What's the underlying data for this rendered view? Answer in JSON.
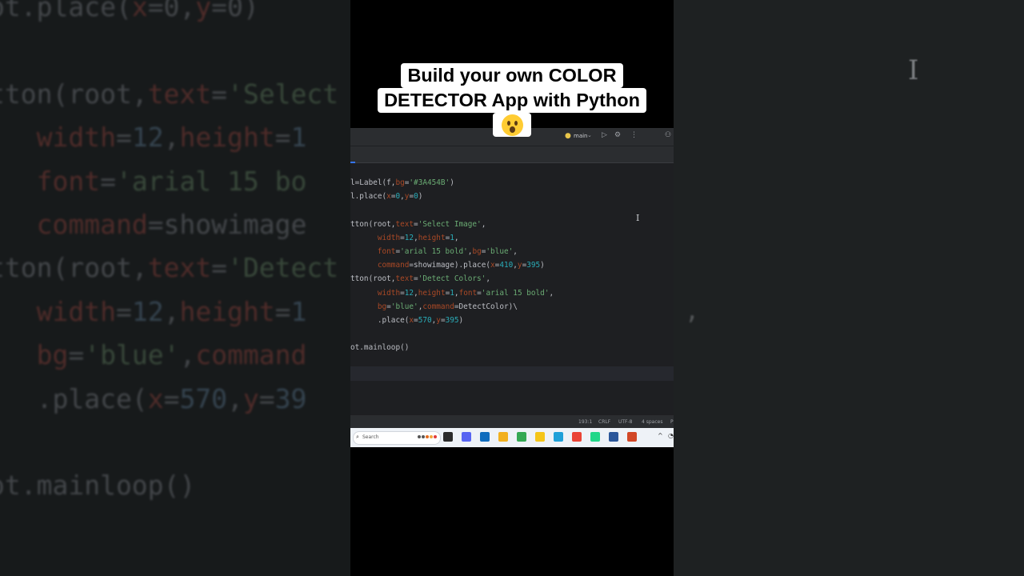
{
  "caption": {
    "line1": "Build your own COLOR",
    "line2": "DETECTOR App with Python",
    "emoji": "astonished-face-emoji"
  },
  "ide": {
    "branch": "main",
    "toolbar_icons": [
      "python-icon",
      "chevron-down-icon",
      "run-icon",
      "debug-icon",
      "more-icon",
      "account-icon"
    ],
    "status": {
      "position": "193:1",
      "line_ending": "CRLF",
      "encoding": "UTF-8",
      "indent": "4 spaces",
      "edge": "P"
    }
  },
  "code_lines": [
    [
      {
        "t": "l=Label(f,",
        "c": "tx"
      },
      {
        "t": "bg",
        "c": "pa"
      },
      {
        "t": "=",
        "c": "tx"
      },
      {
        "t": "'#3A454B'",
        "c": "st"
      },
      {
        "t": ")",
        "c": "tx"
      }
    ],
    [
      {
        "t": "l.place(",
        "c": "tx"
      },
      {
        "t": "x",
        "c": "pa"
      },
      {
        "t": "=",
        "c": "tx"
      },
      {
        "t": "0",
        "c": "nm"
      },
      {
        "t": ",",
        "c": "tx"
      },
      {
        "t": "y",
        "c": "pa"
      },
      {
        "t": "=",
        "c": "tx"
      },
      {
        "t": "0",
        "c": "nm"
      },
      {
        "t": ")",
        "c": "tx"
      }
    ],
    [],
    [
      {
        "t": "tton(root,",
        "c": "tx"
      },
      {
        "t": "text",
        "c": "pa"
      },
      {
        "t": "=",
        "c": "tx"
      },
      {
        "t": "'Select Image'",
        "c": "st"
      },
      {
        "t": ",",
        "c": "tx"
      }
    ],
    [
      {
        "t": "      ",
        "c": "tx"
      },
      {
        "t": "width",
        "c": "pa"
      },
      {
        "t": "=",
        "c": "tx"
      },
      {
        "t": "12",
        "c": "nm"
      },
      {
        "t": ",",
        "c": "tx"
      },
      {
        "t": "height",
        "c": "pa"
      },
      {
        "t": "=",
        "c": "tx"
      },
      {
        "t": "1",
        "c": "nm"
      },
      {
        "t": ",",
        "c": "tx"
      }
    ],
    [
      {
        "t": "      ",
        "c": "tx"
      },
      {
        "t": "font",
        "c": "pa"
      },
      {
        "t": "=",
        "c": "tx"
      },
      {
        "t": "'arial 15 bold'",
        "c": "st"
      },
      {
        "t": ",",
        "c": "tx"
      },
      {
        "t": "bg",
        "c": "pa"
      },
      {
        "t": "=",
        "c": "tx"
      },
      {
        "t": "'blue'",
        "c": "st"
      },
      {
        "t": ",",
        "c": "tx"
      }
    ],
    [
      {
        "t": "      ",
        "c": "tx"
      },
      {
        "t": "command",
        "c": "pa"
      },
      {
        "t": "=showimage).place(",
        "c": "tx"
      },
      {
        "t": "x",
        "c": "pa"
      },
      {
        "t": "=",
        "c": "tx"
      },
      {
        "t": "410",
        "c": "nm"
      },
      {
        "t": ",",
        "c": "tx"
      },
      {
        "t": "y",
        "c": "pa"
      },
      {
        "t": "=",
        "c": "tx"
      },
      {
        "t": "395",
        "c": "nm"
      },
      {
        "t": ")",
        "c": "tx"
      }
    ],
    [
      {
        "t": "tton(root,",
        "c": "tx"
      },
      {
        "t": "text",
        "c": "pa"
      },
      {
        "t": "=",
        "c": "tx"
      },
      {
        "t": "'Detect Colors'",
        "c": "st"
      },
      {
        "t": ",",
        "c": "tx"
      }
    ],
    [
      {
        "t": "      ",
        "c": "tx"
      },
      {
        "t": "width",
        "c": "pa"
      },
      {
        "t": "=",
        "c": "tx"
      },
      {
        "t": "12",
        "c": "nm"
      },
      {
        "t": ",",
        "c": "tx"
      },
      {
        "t": "height",
        "c": "pa"
      },
      {
        "t": "=",
        "c": "tx"
      },
      {
        "t": "1",
        "c": "nm"
      },
      {
        "t": ",",
        "c": "tx"
      },
      {
        "t": "font",
        "c": "pa"
      },
      {
        "t": "=",
        "c": "tx"
      },
      {
        "t": "'arial 15 bold'",
        "c": "st"
      },
      {
        "t": ",",
        "c": "tx"
      }
    ],
    [
      {
        "t": "      ",
        "c": "tx"
      },
      {
        "t": "bg",
        "c": "pa"
      },
      {
        "t": "=",
        "c": "tx"
      },
      {
        "t": "'blue'",
        "c": "st"
      },
      {
        "t": ",",
        "c": "tx"
      },
      {
        "t": "command",
        "c": "pa"
      },
      {
        "t": "=DetectColor)\\",
        "c": "tx"
      }
    ],
    [
      {
        "t": "      .place(",
        "c": "tx"
      },
      {
        "t": "x",
        "c": "pa"
      },
      {
        "t": "=",
        "c": "tx"
      },
      {
        "t": "570",
        "c": "nm"
      },
      {
        "t": ",",
        "c": "tx"
      },
      {
        "t": "y",
        "c": "pa"
      },
      {
        "t": "=",
        "c": "tx"
      },
      {
        "t": "395",
        "c": "nm"
      },
      {
        "t": ")",
        "c": "tx"
      }
    ],
    [],
    [
      {
        "t": "ot.mainloop()",
        "c": "tx"
      }
    ]
  ],
  "background_code": {
    "left_lines": [
      [
        {
          "t": "ot.place(",
          "c": "fn"
        },
        {
          "t": "x",
          "c": "kw"
        },
        {
          "t": "=0,",
          "c": "fn"
        },
        {
          "t": "y",
          "c": "kw"
        },
        {
          "t": "=0)",
          "c": "fn"
        }
      ],
      [],
      [
        {
          "t": "tton(root,",
          "c": "fn"
        },
        {
          "t": "text",
          "c": "kw"
        },
        {
          "t": "=",
          "c": "fn"
        },
        {
          "t": "'Select",
          "c": "st"
        }
      ],
      [
        {
          "t": "   ",
          "c": "fn"
        },
        {
          "t": "width",
          "c": "kw"
        },
        {
          "t": "=",
          "c": "fn"
        },
        {
          "t": "12",
          "c": "nm"
        },
        {
          "t": ",",
          "c": "fn"
        },
        {
          "t": "height",
          "c": "kw"
        },
        {
          "t": "=",
          "c": "fn"
        },
        {
          "t": "1",
          "c": "nm"
        }
      ],
      [
        {
          "t": "   ",
          "c": "fn"
        },
        {
          "t": "font",
          "c": "kw"
        },
        {
          "t": "=",
          "c": "fn"
        },
        {
          "t": "'arial 15 bo",
          "c": "st"
        }
      ],
      [
        {
          "t": "   ",
          "c": "fn"
        },
        {
          "t": "command",
          "c": "kw"
        },
        {
          "t": "=showimage",
          "c": "fn"
        }
      ],
      [
        {
          "t": "tton(root,",
          "c": "fn"
        },
        {
          "t": "text",
          "c": "kw"
        },
        {
          "t": "=",
          "c": "fn"
        },
        {
          "t": "'Detect",
          "c": "st"
        }
      ],
      [
        {
          "t": "   ",
          "c": "fn"
        },
        {
          "t": "width",
          "c": "kw"
        },
        {
          "t": "=",
          "c": "fn"
        },
        {
          "t": "12",
          "c": "nm"
        },
        {
          "t": ",",
          "c": "fn"
        },
        {
          "t": "height",
          "c": "kw"
        },
        {
          "t": "=",
          "c": "fn"
        },
        {
          "t": "1",
          "c": "nm"
        }
      ],
      [
        {
          "t": "   ",
          "c": "fn"
        },
        {
          "t": "bg",
          "c": "kw"
        },
        {
          "t": "=",
          "c": "fn"
        },
        {
          "t": "'blue'",
          "c": "st"
        },
        {
          "t": ",",
          "c": "fn"
        },
        {
          "t": "command",
          "c": "kw"
        }
      ],
      [
        {
          "t": "   .place(",
          "c": "fn"
        },
        {
          "t": "x",
          "c": "kw"
        },
        {
          "t": "=",
          "c": "fn"
        },
        {
          "t": "570",
          "c": "nm"
        },
        {
          "t": ",",
          "c": "fn"
        },
        {
          "t": "y",
          "c": "kw"
        },
        {
          "t": "=",
          "c": "fn"
        },
        {
          "t": "39",
          "c": "nm"
        }
      ],
      [],
      [
        {
          "t": "ot.mainloop()",
          "c": "fn"
        }
      ]
    ]
  },
  "taskbar": {
    "search_placeholder": "Search",
    "apps": [
      {
        "icon": "widgets-icon",
        "color": "#2b2b2b"
      },
      {
        "icon": "discord-icon",
        "color": "#5865f2"
      },
      {
        "icon": "store-icon",
        "color": "#0f6cbd"
      },
      {
        "icon": "file-explorer-icon",
        "color": "#f2b01e"
      },
      {
        "icon": "chrome-icon",
        "color": "#34a853"
      },
      {
        "icon": "photos-icon",
        "color": "#f5c518"
      },
      {
        "icon": "edge-icon",
        "color": "#1fa0d8"
      },
      {
        "icon": "chrome-profile-icon",
        "color": "#ea4335"
      },
      {
        "icon": "pycharm-icon",
        "color": "#21d789"
      },
      {
        "icon": "word-icon",
        "color": "#2b579a"
      },
      {
        "icon": "powerpoint-icon",
        "color": "#d24726"
      }
    ],
    "tray": [
      "chevron-up-icon",
      "network-icon"
    ]
  },
  "colors": {
    "editor_bg": "#1e1f22",
    "keyword_param": "#aa4926",
    "string": "#6aab73",
    "number": "#2aacb8"
  }
}
